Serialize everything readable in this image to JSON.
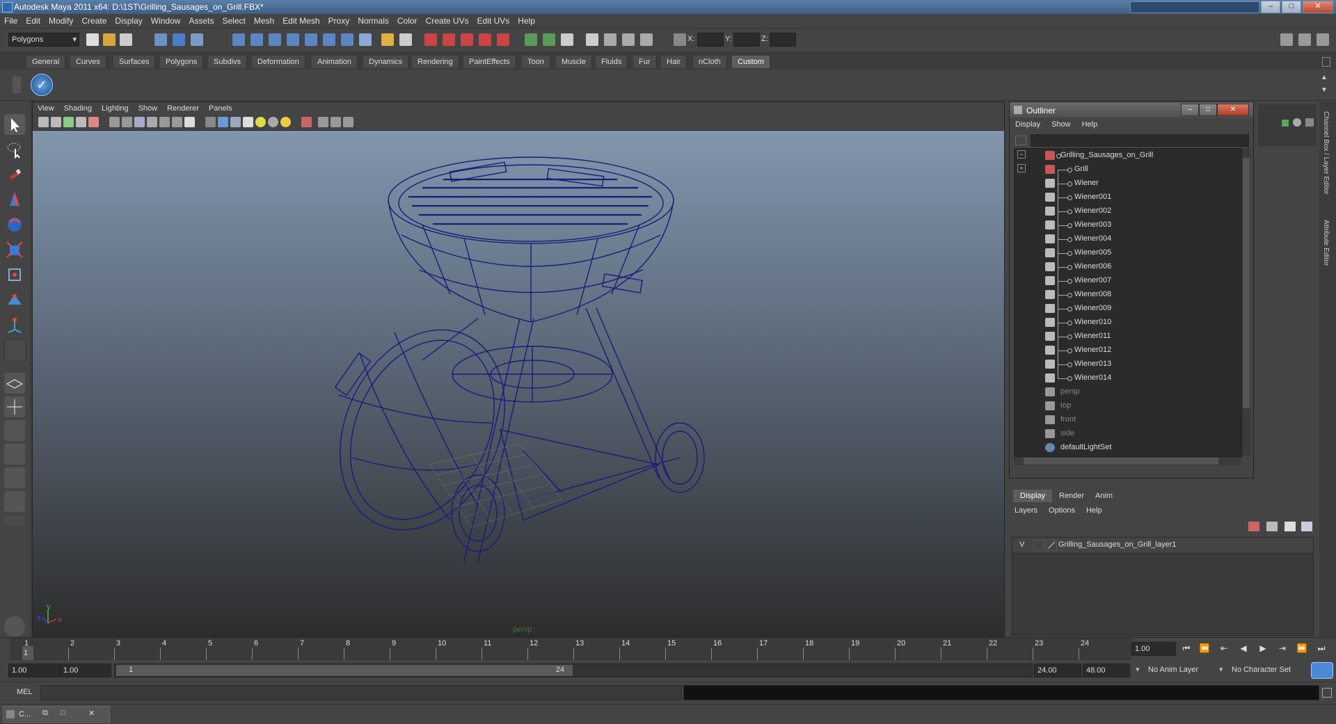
{
  "window": {
    "title": "Autodesk Maya 2011 x64: D:\\1ST\\Grilling_Sausages_on_Grill.FBX*"
  },
  "menubar": [
    "File",
    "Edit",
    "Modify",
    "Create",
    "Display",
    "Window",
    "Assets",
    "Select",
    "Mesh",
    "Edit Mesh",
    "Proxy",
    "Normals",
    "Color",
    "Create UVs",
    "Edit UVs",
    "Help"
  ],
  "toolbar": {
    "mode": "Polygons",
    "x_label": "X:",
    "y_label": "Y:",
    "z_label": "Z:"
  },
  "shelf_tabs": [
    "General",
    "Curves",
    "Surfaces",
    "Polygons",
    "Subdivs",
    "Deformation",
    "Animation",
    "Dynamics",
    "Rendering",
    "PaintEffects",
    "Toon",
    "Muscle",
    "Fluids",
    "Fur",
    "Hair",
    "nCloth",
    "Custom"
  ],
  "shelf_active": "Custom",
  "viewport": {
    "menu": [
      "View",
      "Shading",
      "Lighting",
      "Show",
      "Renderer",
      "Panels"
    ],
    "camera": "persp",
    "axis_x": "x",
    "axis_y": "y",
    "axis_z": "z"
  },
  "outliner": {
    "title": "Outliner",
    "menu": [
      "Display",
      "Show",
      "Help"
    ],
    "items": [
      {
        "label": "Grilling_Sausages_on_Grill",
        "level": 0,
        "type": "group",
        "expand": "−"
      },
      {
        "label": "Grill",
        "level": 1,
        "type": "group",
        "expand": "+"
      },
      {
        "label": "Wiener",
        "level": 1,
        "type": "mesh"
      },
      {
        "label": "Wiener001",
        "level": 1,
        "type": "mesh"
      },
      {
        "label": "Wiener002",
        "level": 1,
        "type": "mesh"
      },
      {
        "label": "Wiener003",
        "level": 1,
        "type": "mesh"
      },
      {
        "label": "Wiener004",
        "level": 1,
        "type": "mesh"
      },
      {
        "label": "Wiener005",
        "level": 1,
        "type": "mesh"
      },
      {
        "label": "Wiener006",
        "level": 1,
        "type": "mesh"
      },
      {
        "label": "Wiener007",
        "level": 1,
        "type": "mesh"
      },
      {
        "label": "Wiener008",
        "level": 1,
        "type": "mesh"
      },
      {
        "label": "Wiener009",
        "level": 1,
        "type": "mesh"
      },
      {
        "label": "Wiener010",
        "level": 1,
        "type": "mesh"
      },
      {
        "label": "Wiener011",
        "level": 1,
        "type": "mesh"
      },
      {
        "label": "Wiener012",
        "level": 1,
        "type": "mesh"
      },
      {
        "label": "Wiener013",
        "level": 1,
        "type": "mesh"
      },
      {
        "label": "Wiener014",
        "level": 1,
        "type": "mesh"
      },
      {
        "label": "persp",
        "level": 0,
        "type": "camera"
      },
      {
        "label": "top",
        "level": 0,
        "type": "camera"
      },
      {
        "label": "front",
        "level": 0,
        "type": "camera"
      },
      {
        "label": "side",
        "level": 0,
        "type": "camera"
      },
      {
        "label": "defaultLightSet",
        "level": 0,
        "type": "set"
      }
    ]
  },
  "layer_editor": {
    "tabs": [
      "Display",
      "Render",
      "Anim"
    ],
    "active_tab": "Display",
    "menu": [
      "Layers",
      "Options",
      "Help"
    ],
    "layers": [
      {
        "visible": "V",
        "name": "Grilling_Sausages_on_Grill_layer1"
      }
    ]
  },
  "side_tabs": [
    "Channel Box / Layer Editor",
    "Attribute Editor"
  ],
  "timeline": {
    "ticks": [
      "1",
      "2",
      "3",
      "4",
      "5",
      "6",
      "7",
      "8",
      "9",
      "10",
      "11",
      "12",
      "13",
      "14",
      "15",
      "16",
      "17",
      "18",
      "19",
      "20",
      "21",
      "22",
      "23",
      "24"
    ],
    "current_frame_marker": "1",
    "current_time": "1.00"
  },
  "range": {
    "start": "1.00",
    "playback_start": "1.00",
    "slider_start": "1",
    "slider_end": "24",
    "playback_end": "24.00",
    "end": "48.00",
    "anim_layer": "No Anim Layer",
    "character_set": "No Character Set"
  },
  "command_line": {
    "label": "MEL"
  },
  "taskbar": {
    "item": "C..."
  },
  "colors": {
    "wire": "#1a1a7a",
    "accent": "#5d5d5d"
  }
}
